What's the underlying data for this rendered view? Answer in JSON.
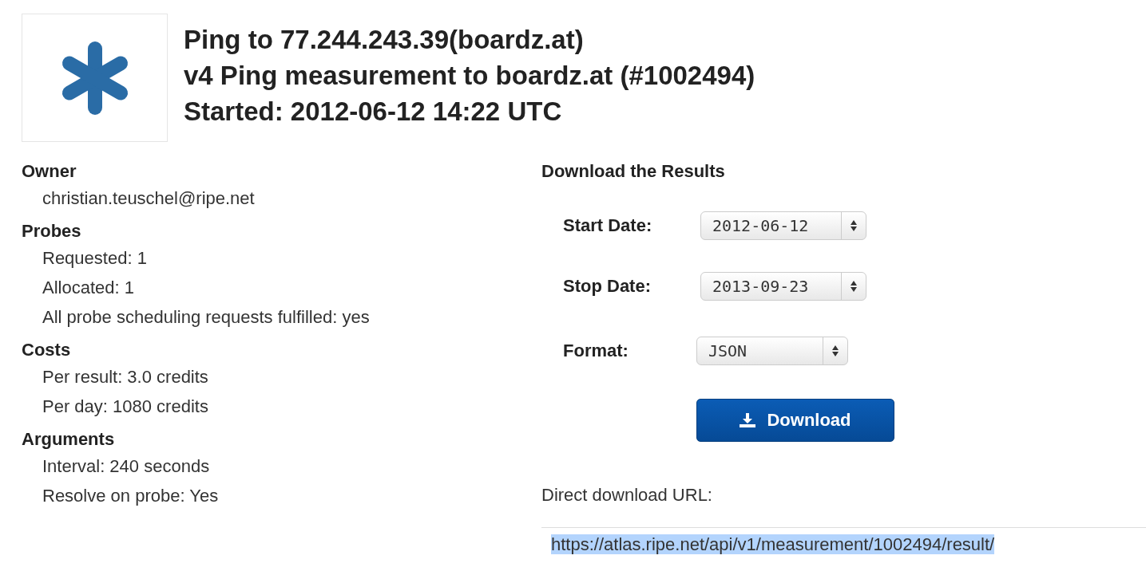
{
  "header": {
    "title_lines": [
      "Ping to 77.244.243.39(boardz.at)",
      "v4 Ping measurement to boardz.at (#1002494)",
      "Started: 2012-06-12 14:22 UTC"
    ]
  },
  "sections": [
    {
      "heading": "Owner",
      "items": [
        "christian.teuschel@ripe.net"
      ]
    },
    {
      "heading": "Probes",
      "items": [
        "Requested: 1",
        "Allocated: 1",
        "All probe scheduling requests fulfilled: yes"
      ]
    },
    {
      "heading": "Costs",
      "items": [
        "Per result: 3.0 credits",
        "Per day: 1080 credits"
      ]
    },
    {
      "heading": "Arguments",
      "items": [
        "Interval: 240 seconds",
        "Resolve on probe: Yes"
      ]
    }
  ],
  "download": {
    "heading": "Download the Results",
    "fields": [
      {
        "label": "Start Date:",
        "value": "2012-06-12",
        "kind": "date"
      },
      {
        "label": "Stop Date:",
        "value": "2013-09-23",
        "kind": "date"
      },
      {
        "label": "Format:",
        "value": "JSON",
        "kind": "format"
      }
    ],
    "button": "Download",
    "url_label": "Direct download URL:",
    "url": {
      "text": "https://atlas.ripe.net/api/v1/measurement/1002494/result/",
      "selected": true
    }
  }
}
